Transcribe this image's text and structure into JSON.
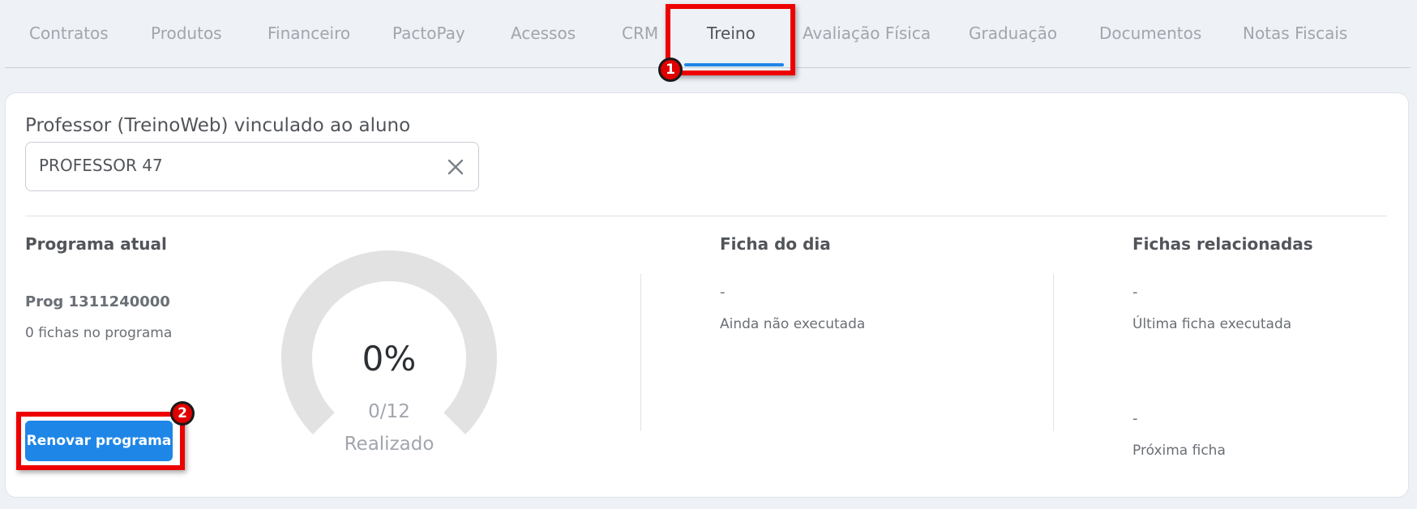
{
  "tabs": [
    {
      "label": "Contratos",
      "active": false
    },
    {
      "label": "Produtos",
      "active": false
    },
    {
      "label": "Financeiro",
      "active": false
    },
    {
      "label": "PactoPay",
      "active": false
    },
    {
      "label": "Acessos",
      "active": false
    },
    {
      "label": "CRM",
      "active": false
    },
    {
      "label": "Treino",
      "active": true
    },
    {
      "label": "Avaliação Física",
      "active": false
    },
    {
      "label": "Graduação",
      "active": false
    },
    {
      "label": "Documentos",
      "active": false
    },
    {
      "label": "Notas Fiscais",
      "active": false
    }
  ],
  "annotations": {
    "step1": "1",
    "step2": "2",
    "highlight_color": "#ee0000"
  },
  "professor": {
    "label": "Professor (TreinoWeb) vinculado ao aluno",
    "value": "PROFESSOR 47",
    "clear_icon": "close-icon"
  },
  "programa": {
    "title": "Programa atual",
    "name": "Prog 1311240000",
    "count": "0 fichas  no programa",
    "renew_label": "Renovar programa"
  },
  "gauge": {
    "percent_label": "0%",
    "progress": 0,
    "fraction": "0/12",
    "label": "Realizado",
    "track_color": "#e2e2e2",
    "fill_color": "#1e86e6"
  },
  "ficha_dia": {
    "title": "Ficha do dia",
    "value": "-",
    "status": "Ainda não executada"
  },
  "fichas_relacionadas": {
    "title": "Fichas relacionadas",
    "ultima_value": "-",
    "ultima_label": "Última ficha executada",
    "proxima_value": "-",
    "proxima_label": "Próxima ficha"
  },
  "colors": {
    "accent": "#1e86e6",
    "background": "#eef1f6"
  }
}
